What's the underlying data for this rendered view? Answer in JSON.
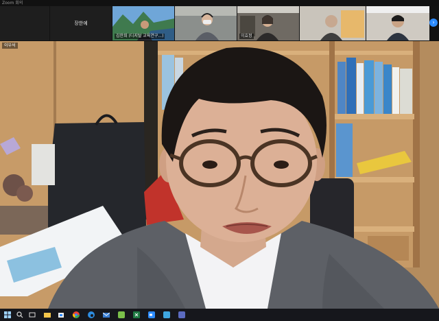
{
  "window": {
    "title": "Zoom 회의"
  },
  "strip": {
    "tiles": [
      {
        "name": "",
        "kind": "blank"
      },
      {
        "name": "장한예",
        "kind": "name-only"
      },
      {
        "name": "김한희 (디지털 교육연구...)",
        "kind": "video"
      },
      {
        "name": "",
        "kind": "video"
      },
      {
        "name": "이효정",
        "kind": "video"
      },
      {
        "name": "",
        "kind": "video"
      },
      {
        "name": "",
        "kind": "video"
      }
    ],
    "scroll_icon": "chevron-right-icon"
  },
  "main": {
    "speaker_name": "이우석"
  },
  "taskbar": {
    "icons": [
      "windows-start-icon",
      "search-icon",
      "task-view-icon",
      "explorer-icon",
      "store-icon",
      "chrome-icon",
      "edge-icon",
      "mail-icon",
      "app-icon",
      "excel-icon",
      "zoom-icon",
      "app-icon",
      "app-icon"
    ]
  }
}
